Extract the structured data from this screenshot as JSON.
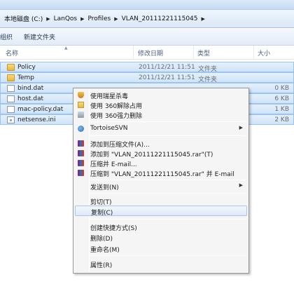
{
  "breadcrumb": [
    {
      "label": "本地磁盘 (C:)"
    },
    {
      "label": "LanQos"
    },
    {
      "label": "Profiles"
    },
    {
      "label": "VLAN_20111221115045"
    }
  ],
  "toolbar": {
    "organize_label": "组织",
    "new_folder_label": "新建文件夹"
  },
  "columns": {
    "name": "名称",
    "date": "修改日期",
    "type": "类型",
    "size": "大小"
  },
  "files": [
    {
      "name": "Policy",
      "date": "2011/12/21 11:51",
      "type": "文件夹",
      "size": "",
      "icon": "folder-icon"
    },
    {
      "name": "Temp",
      "date": "2011/12/21 11:51",
      "type": "文件夹",
      "size": "",
      "icon": "folder-icon"
    },
    {
      "name": "bind.dat",
      "date": "",
      "type": "",
      "size": "0 KB",
      "icon": "file-icon"
    },
    {
      "name": "host.dat",
      "date": "",
      "type": "",
      "size": "6 KB",
      "icon": "file-icon"
    },
    {
      "name": "mac-policy.dat",
      "date": "",
      "type": "",
      "size": "1 KB",
      "icon": "file-icon"
    },
    {
      "name": "netsense.ini",
      "date": "",
      "type": "",
      "size": "2 KB",
      "icon": "ini-icon"
    }
  ],
  "context_menu": {
    "scan": "使用瑞星杀毒",
    "unlock_360": "使用 360解除占用",
    "shred_360": "使用 360强力删除",
    "tortoise": "TortoiseSVN",
    "add_archive": "添加到压缩文件(A)...",
    "add_named": "添加到 \"VLAN_20111221115045.rar\"(T)",
    "compress_email": "压缩并 E-mail...",
    "compress_named_email": "压缩到 \"VLAN_20111221115045.rar\" 并 E-mail",
    "send_to": "发送到(N)",
    "cut": "剪切(T)",
    "copy": "复制(C)",
    "create_shortcut": "创建快捷方式(S)",
    "delete": "删除(D)",
    "rename": "重命名(M)",
    "properties": "属性(R)"
  },
  "colors": {
    "selection": "#cfe4f9",
    "menu_highlight": "#dfeaf7"
  }
}
